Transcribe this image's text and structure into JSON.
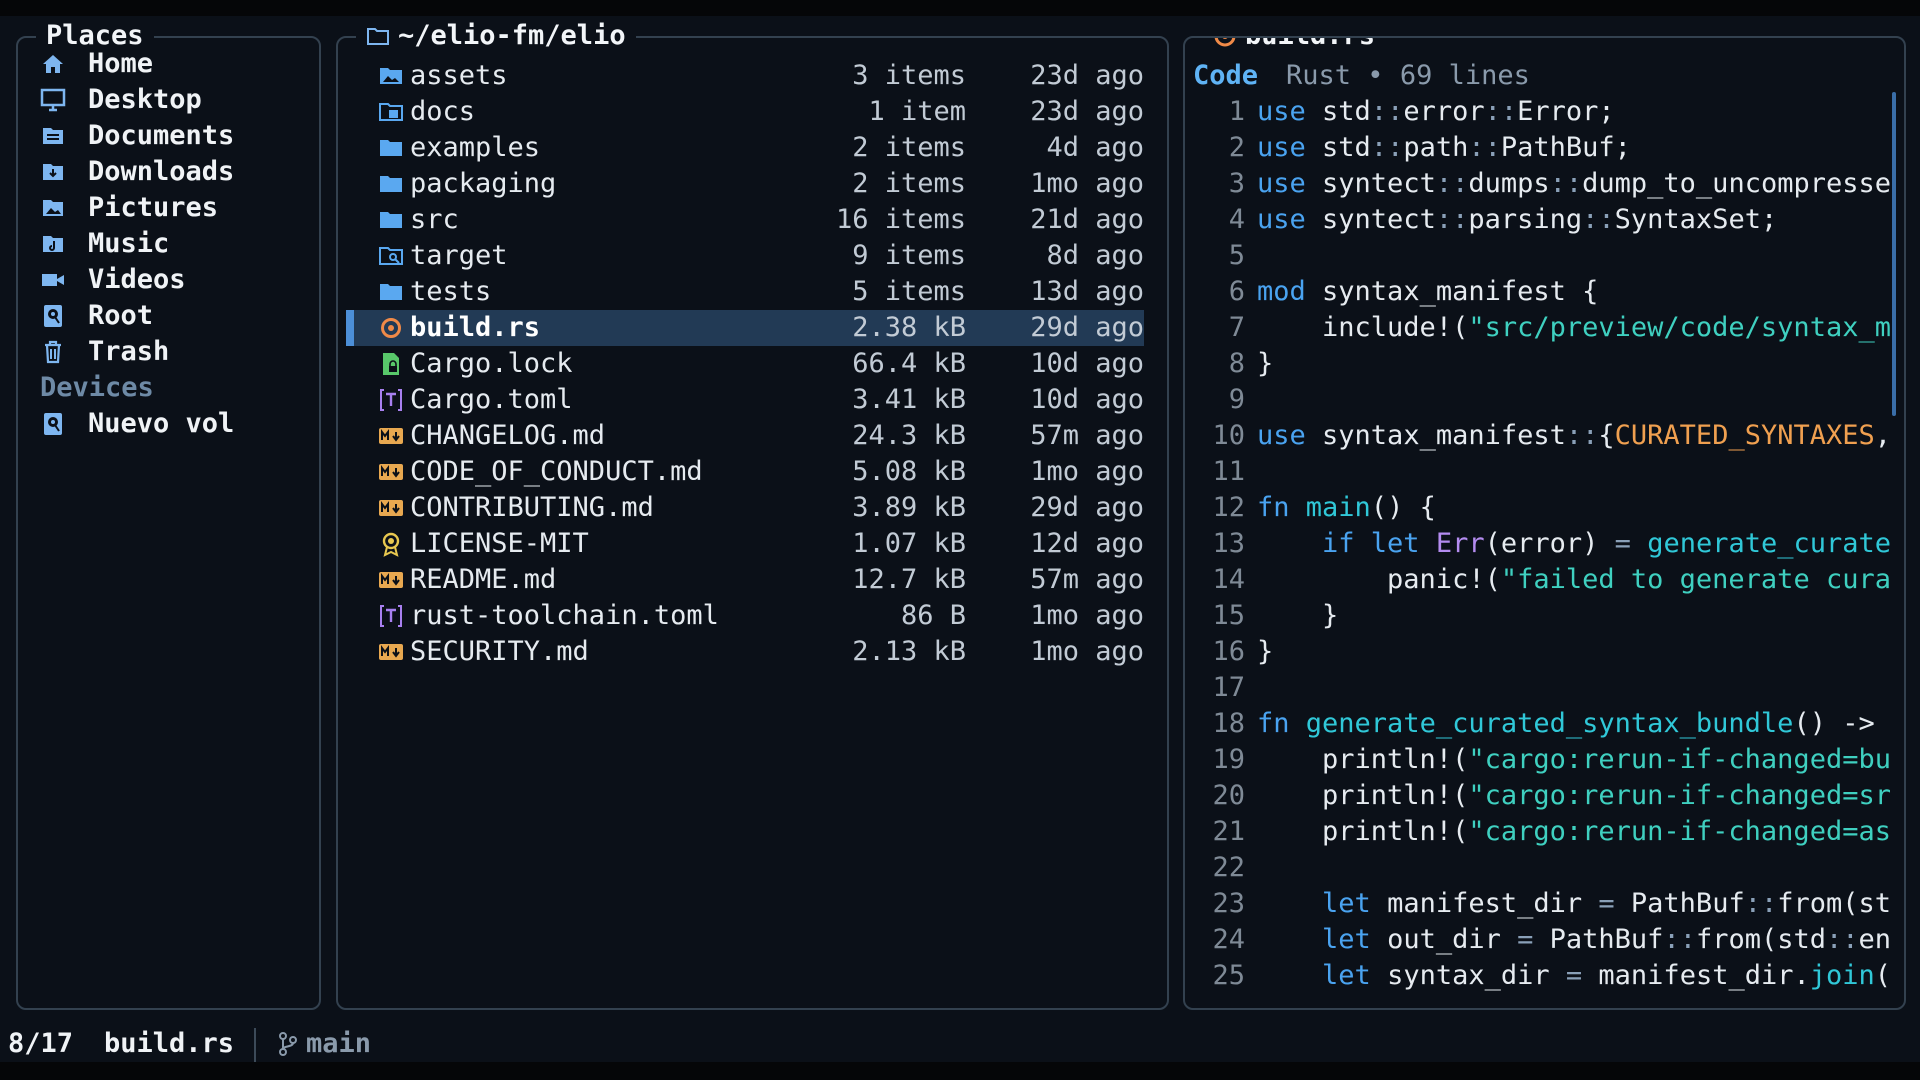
{
  "places": {
    "title": "Places",
    "items": [
      {
        "label": "Home",
        "icon": "home-icon"
      },
      {
        "label": "Desktop",
        "icon": "monitor-icon"
      },
      {
        "label": "Documents",
        "icon": "documents-folder-icon"
      },
      {
        "label": "Downloads",
        "icon": "downloads-folder-icon"
      },
      {
        "label": "Pictures",
        "icon": "pictures-folder-icon"
      },
      {
        "label": "Music",
        "icon": "music-folder-icon"
      },
      {
        "label": "Videos",
        "icon": "video-camera-icon"
      },
      {
        "label": "Root",
        "icon": "drive-icon"
      },
      {
        "label": "Trash",
        "icon": "trash-icon"
      }
    ],
    "devices_label": "Devices",
    "devices": [
      {
        "label": "Nuevo vol",
        "icon": "drive-icon"
      }
    ]
  },
  "files": {
    "path": "~/elio-fm/elio",
    "rows": [
      {
        "name": "assets",
        "size": "3 items",
        "modified": "23d ago",
        "icon": "image-folder-icon",
        "color": "#5aa8f0"
      },
      {
        "name": "docs",
        "size": "1 item",
        "modified": "23d ago",
        "icon": "docs-folder-icon",
        "color": "#5aa8f0"
      },
      {
        "name": "examples",
        "size": "2 items",
        "modified": "4d ago",
        "icon": "folder-icon",
        "color": "#5aa8f0"
      },
      {
        "name": "packaging",
        "size": "2 items",
        "modified": "1mo ago",
        "icon": "folder-icon",
        "color": "#5aa8f0"
      },
      {
        "name": "src",
        "size": "16 items",
        "modified": "21d ago",
        "icon": "folder-icon",
        "color": "#5aa8f0"
      },
      {
        "name": "target",
        "size": "9 items",
        "modified": "8d ago",
        "icon": "search-folder-icon",
        "color": "#5aa8f0"
      },
      {
        "name": "tests",
        "size": "5 items",
        "modified": "13d ago",
        "icon": "folder-icon",
        "color": "#5aa8f0"
      },
      {
        "name": "build.rs",
        "size": "2.38 kB",
        "modified": "29d ago",
        "icon": "rust-icon",
        "color": "#f08a48"
      },
      {
        "name": "Cargo.lock",
        "size": "66.4 kB",
        "modified": "10d ago",
        "icon": "lock-file-icon",
        "color": "#58c86a"
      },
      {
        "name": "Cargo.toml",
        "size": "3.41 kB",
        "modified": "10d ago",
        "icon": "toml-icon",
        "color": "#a880f0"
      },
      {
        "name": "CHANGELOG.md",
        "size": "24.3 kB",
        "modified": "57m ago",
        "icon": "markdown-icon",
        "color": "#e8a850"
      },
      {
        "name": "CODE_OF_CONDUCT.md",
        "size": "5.08 kB",
        "modified": "1mo ago",
        "icon": "markdown-icon",
        "color": "#e8a850"
      },
      {
        "name": "CONTRIBUTING.md",
        "size": "3.89 kB",
        "modified": "29d ago",
        "icon": "markdown-icon",
        "color": "#e8a850"
      },
      {
        "name": "LICENSE-MIT",
        "size": "1.07 kB",
        "modified": "12d ago",
        "icon": "license-icon",
        "color": "#e8c850"
      },
      {
        "name": "README.md",
        "size": "12.7 kB",
        "modified": "57m ago",
        "icon": "markdown-icon",
        "color": "#e8a850"
      },
      {
        "name": "rust-toolchain.toml",
        "size": "86 B",
        "modified": "1mo ago",
        "icon": "toml-icon",
        "color": "#a880f0"
      },
      {
        "name": "SECURITY.md",
        "size": "2.13 kB",
        "modified": "1mo ago",
        "icon": "markdown-icon",
        "color": "#e8a850"
      }
    ],
    "selected_index": 7
  },
  "preview": {
    "title": "build.rs",
    "tag": "Code",
    "meta": "Rust • 69 lines",
    "lines": [
      [
        [
          "kw",
          "use"
        ],
        [
          "pl",
          " std"
        ],
        [
          "op",
          "::"
        ],
        [
          "pl",
          "error"
        ],
        [
          "op",
          "::"
        ],
        [
          "pl",
          "Error;"
        ]
      ],
      [
        [
          "kw",
          "use"
        ],
        [
          "pl",
          " std"
        ],
        [
          "op",
          "::"
        ],
        [
          "pl",
          "path"
        ],
        [
          "op",
          "::"
        ],
        [
          "pl",
          "PathBuf;"
        ]
      ],
      [
        [
          "kw",
          "use"
        ],
        [
          "pl",
          " syntect"
        ],
        [
          "op",
          "::"
        ],
        [
          "pl",
          "dumps"
        ],
        [
          "op",
          "::"
        ],
        [
          "pl",
          "dump_to_uncompresse"
        ]
      ],
      [
        [
          "kw",
          "use"
        ],
        [
          "pl",
          " syntect"
        ],
        [
          "op",
          "::"
        ],
        [
          "pl",
          "parsing"
        ],
        [
          "op",
          "::"
        ],
        [
          "pl",
          "SyntaxSet;"
        ]
      ],
      [],
      [
        [
          "kw",
          "mod"
        ],
        [
          "pl",
          " syntax_manifest {"
        ]
      ],
      [
        [
          "pl",
          "    include!("
        ],
        [
          "str",
          "\"src/preview/code/syntax_m"
        ]
      ],
      [
        [
          "pl",
          "}"
        ]
      ],
      [],
      [
        [
          "kw",
          "use"
        ],
        [
          "pl",
          " syntax_manifest"
        ],
        [
          "op",
          "::"
        ],
        [
          "pl",
          "{"
        ],
        [
          "const",
          "CURATED_SYNTAXES"
        ],
        [
          "pl",
          ","
        ]
      ],
      [],
      [
        [
          "kw",
          "fn"
        ],
        [
          "pl",
          " "
        ],
        [
          "fn",
          "main"
        ],
        [
          "pl",
          "() {"
        ]
      ],
      [
        [
          "pl",
          "    "
        ],
        [
          "kw",
          "if let"
        ],
        [
          "pl",
          " "
        ],
        [
          "ty",
          "Err"
        ],
        [
          "pl",
          "(error) "
        ],
        [
          "op",
          "="
        ],
        [
          "pl",
          " "
        ],
        [
          "fn",
          "generate_curate"
        ]
      ],
      [
        [
          "pl",
          "        panic!("
        ],
        [
          "str",
          "\"failed to generate cura"
        ]
      ],
      [
        [
          "pl",
          "    }"
        ]
      ],
      [
        [
          "pl",
          "}"
        ]
      ],
      [],
      [
        [
          "kw",
          "fn"
        ],
        [
          "pl",
          " "
        ],
        [
          "fn",
          "generate_curated_syntax_bundle"
        ],
        [
          "pl",
          "() ->"
        ]
      ],
      [
        [
          "pl",
          "    println!("
        ],
        [
          "str",
          "\"cargo:rerun-if-changed=bu"
        ]
      ],
      [
        [
          "pl",
          "    println!("
        ],
        [
          "str",
          "\"cargo:rerun-if-changed=sr"
        ]
      ],
      [
        [
          "pl",
          "    println!("
        ],
        [
          "str",
          "\"cargo:rerun-if-changed=as"
        ]
      ],
      [],
      [
        [
          "pl",
          "    "
        ],
        [
          "kw",
          "let"
        ],
        [
          "pl",
          " manifest_dir "
        ],
        [
          "op",
          "="
        ],
        [
          "pl",
          " PathBuf"
        ],
        [
          "op",
          "::"
        ],
        [
          "pl",
          "from(st"
        ]
      ],
      [
        [
          "pl",
          "    "
        ],
        [
          "kw",
          "let"
        ],
        [
          "pl",
          " out_dir "
        ],
        [
          "op",
          "="
        ],
        [
          "pl",
          " PathBuf"
        ],
        [
          "op",
          "::"
        ],
        [
          "pl",
          "from(std"
        ],
        [
          "op",
          "::"
        ],
        [
          "pl",
          "en"
        ]
      ],
      [
        [
          "pl",
          "    "
        ],
        [
          "kw",
          "let"
        ],
        [
          "pl",
          " syntax_dir "
        ],
        [
          "op",
          "="
        ],
        [
          "pl",
          " manifest_dir."
        ],
        [
          "fn",
          "join"
        ],
        [
          "pl",
          "("
        ]
      ]
    ]
  },
  "status": {
    "position": "8/17",
    "current": "build.rs",
    "branch": "main"
  }
}
